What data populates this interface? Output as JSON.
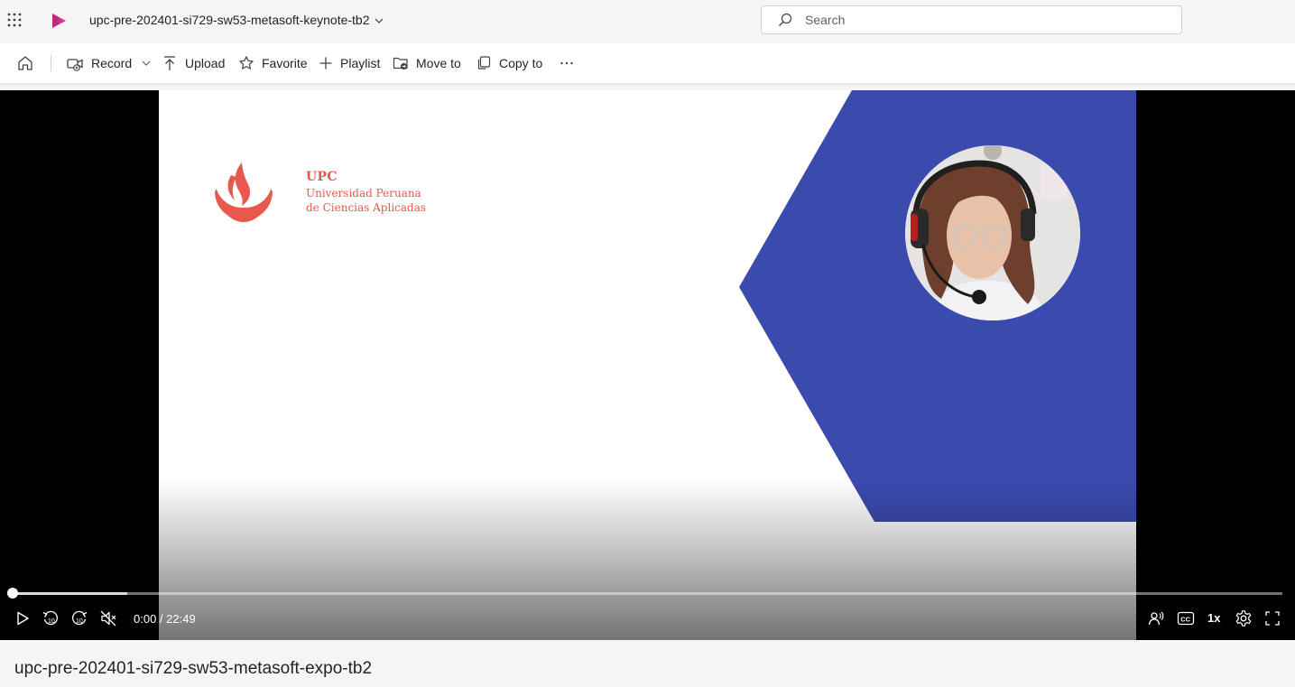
{
  "topbar": {
    "document_title": "upc-pre-202401-si729-sw53-metasoft-keynote-tb2",
    "search_placeholder": "Search",
    "icons": [
      "app-launcher-icon",
      "stream-logo-icon",
      "chevron-down-icon",
      "search-icon"
    ]
  },
  "toolbar": {
    "home_icon": "home-icon",
    "record_label": "Record",
    "upload_label": "Upload",
    "favorite_label": "Favorite",
    "playlist_label": "Playlist",
    "move_label": "Move to",
    "copy_label": "Copy to",
    "more_icon": "more-icon"
  },
  "player": {
    "current_time": "0:00",
    "separator": " / ",
    "duration": "22:49",
    "speed": "1x",
    "progress_fraction": 0.0,
    "buffered_fraction": 0.09,
    "controls": [
      "play-icon",
      "rewind-10-icon",
      "forward-10-icon",
      "mute-icon",
      "audio-description-icon",
      "captions-icon",
      "settings-icon",
      "fullscreen-icon"
    ]
  },
  "slide": {
    "brand_name": "UPC",
    "brand_line1": "Universidad Peruana",
    "brand_line2": "de Ciencias Aplicadas",
    "colors": {
      "blue": "#3B4AAD",
      "coral": "#E8584E"
    }
  },
  "video_title": "upc-pre-202401-si729-sw53-metasoft-expo-tb2"
}
